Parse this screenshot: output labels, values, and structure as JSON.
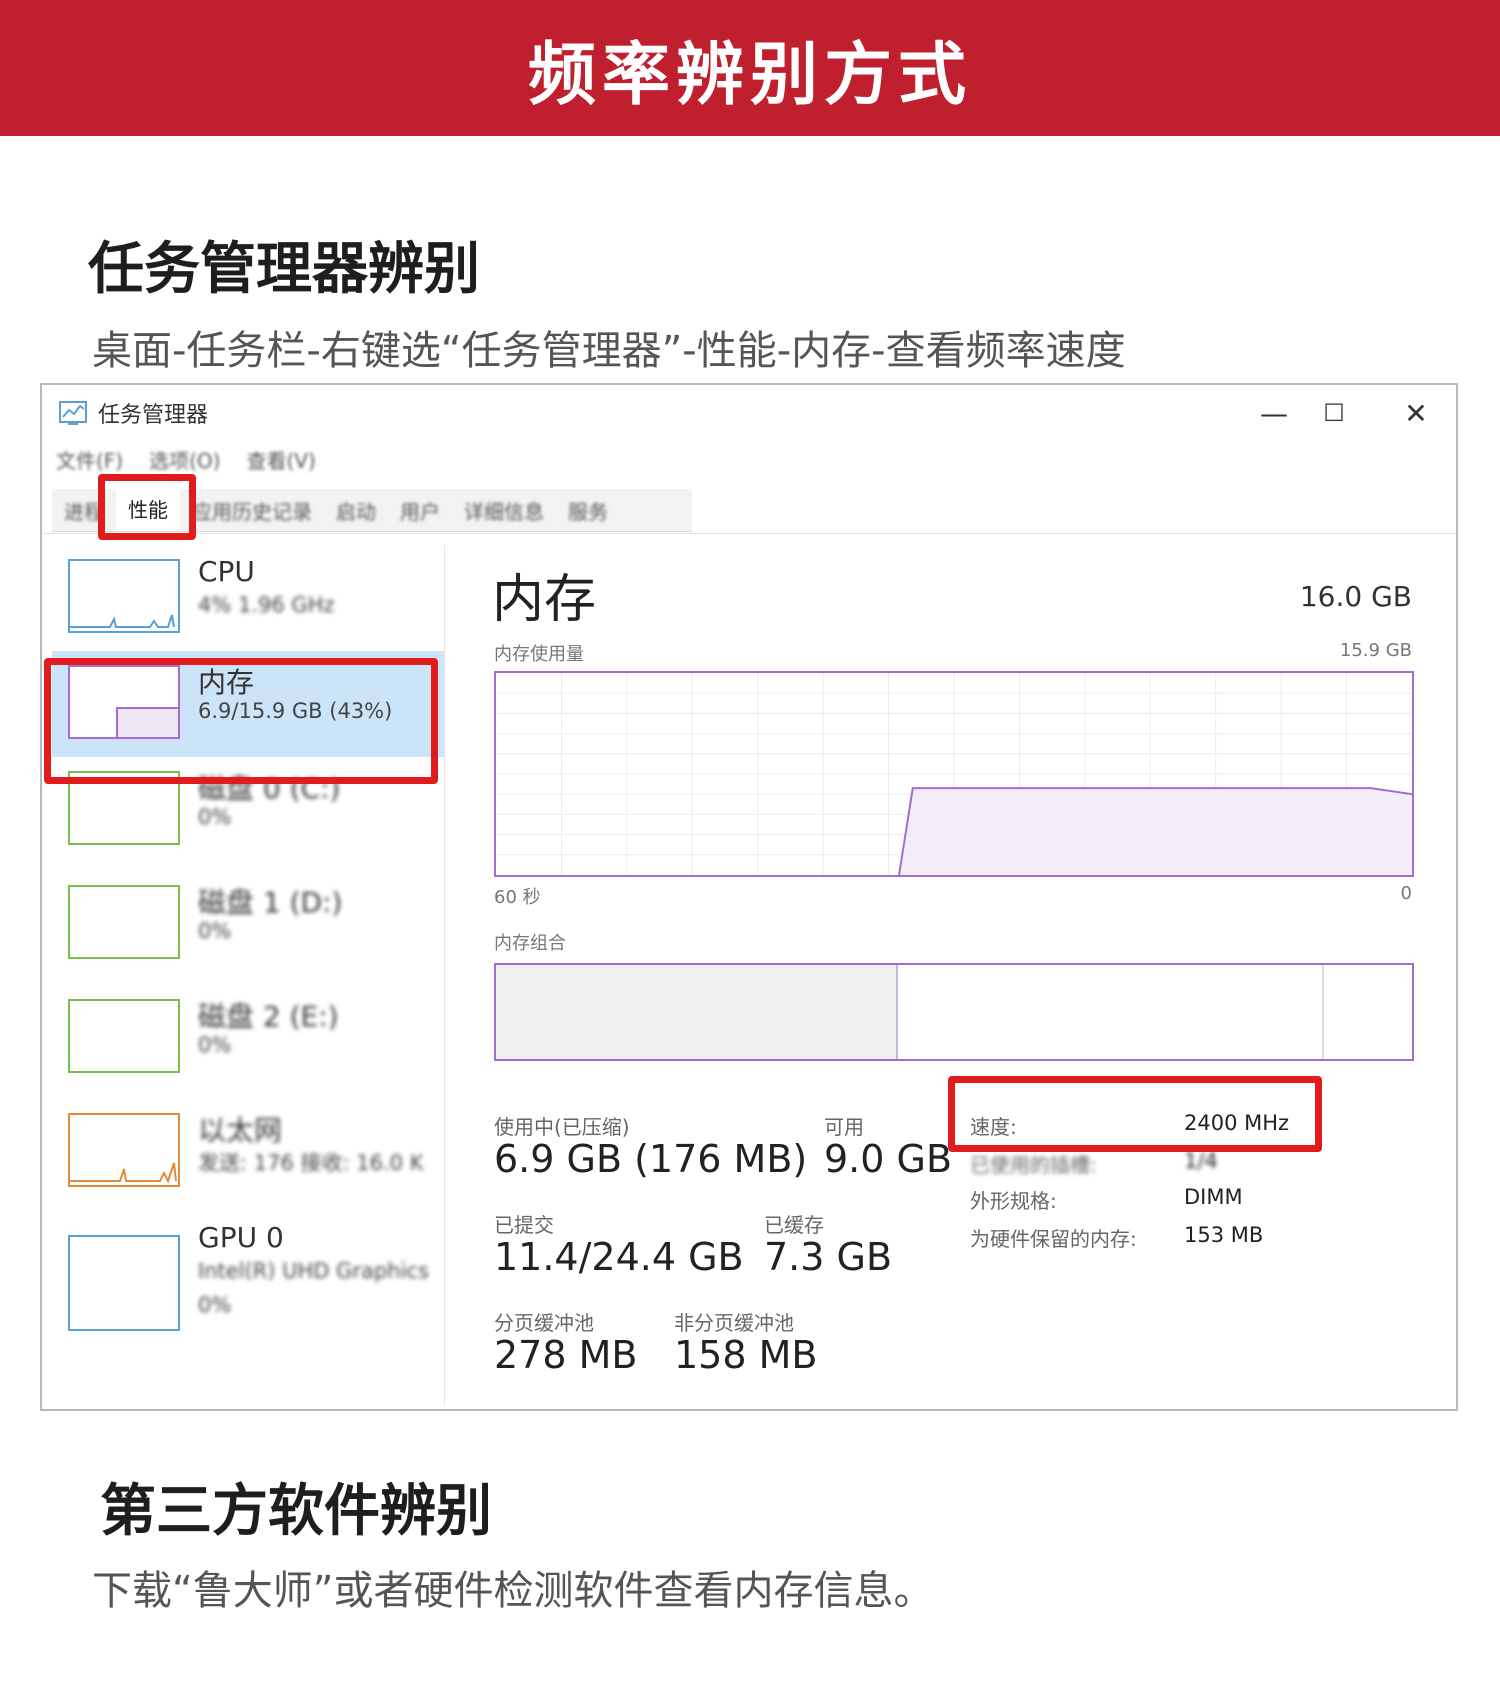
{
  "banner": {
    "title": "频率辨别方式"
  },
  "section1": {
    "title": "任务管理器辨别",
    "desc": "桌面-任务栏-右键选“任务管理器”-性能-内存-查看频率速度"
  },
  "task_manager": {
    "window_title": "任务管理器",
    "window_buttons": {
      "minimize": "—",
      "maximize": "☐",
      "close": "✕"
    },
    "menu": [
      "文件(F)",
      "选项(O)",
      "查看(V)"
    ],
    "tabs": [
      "进程",
      "性能",
      "应用历史记录",
      "启动",
      "用户",
      "详细信息",
      "服务"
    ],
    "active_tab": "性能",
    "sidebar": [
      {
        "name": "CPU",
        "sub": "4% 1.96 GHz",
        "color": "#5aa0d6"
      },
      {
        "name": "内存",
        "sub": "6.9/15.9 GB (43%)",
        "color": "#a46ad6"
      },
      {
        "name": "磁盘 0 (C:)",
        "sub": "0%",
        "color": "#7cbf4a"
      },
      {
        "name": "磁盘 1 (D:)",
        "sub": "0%",
        "color": "#7cbf4a"
      },
      {
        "name": "磁盘 2 (E:)",
        "sub": "0%",
        "color": "#7cbf4a"
      },
      {
        "name": "以太网",
        "sub": "发送: 176 接收: 16.0 K",
        "color": "#e08a3c"
      },
      {
        "name": "GPU 0",
        "sub": "Intel(R) UHD Graphics",
        "sub2": "0%",
        "color": "#5aa0d6"
      }
    ],
    "memory": {
      "title": "内存",
      "total": "16.0 GB",
      "usage_label": "内存使用量",
      "usage_max": "15.9 GB",
      "axis_left": "60 秒",
      "axis_right": "0",
      "usage_fraction": 0.43,
      "composition_label": "内存组合",
      "in_use_label": "使用中(已压缩)",
      "in_use_value": "6.9 GB (176 MB)",
      "available_label": "可用",
      "available_value": "9.0 GB",
      "committed_label": "已提交",
      "committed_value": "11.4/24.4 GB",
      "cached_label": "已缓存",
      "cached_value": "7.3 GB",
      "paged_label": "分页缓冲池",
      "paged_value": "278 MB",
      "nonpaged_label": "非分页缓冲池",
      "nonpaged_value": "158 MB",
      "speed_label": "速度:",
      "speed_value": "2400 MHz",
      "slots_label": "已使用的插槽:",
      "slots_value": "1/4",
      "form_label": "外形规格:",
      "form_value": "DIMM",
      "reserved_label": "为硬件保留的内存:",
      "reserved_value": "153 MB"
    }
  },
  "section2": {
    "title": "第三方软件辨别",
    "desc": "下载“鲁大师”或者硬件检测软件查看内存信息。"
  }
}
